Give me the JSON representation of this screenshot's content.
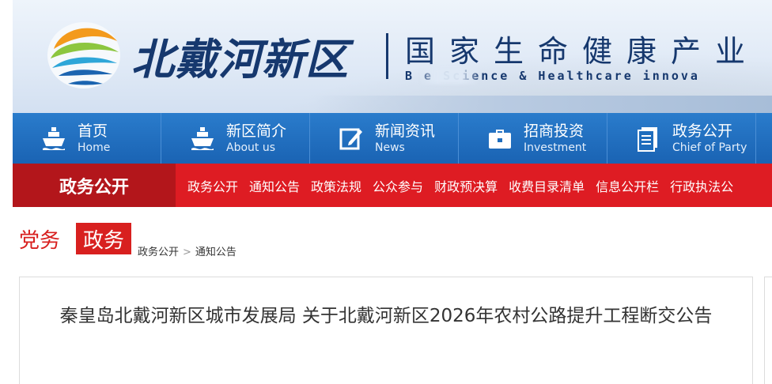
{
  "banner": {
    "logo_name": "北戴河新区",
    "title": "国家生命健康产业",
    "subtitle": "B          e Science & Healthcare innova"
  },
  "nav": {
    "items": [
      {
        "cn": "首页",
        "en": "Home",
        "icon": "ship-icon"
      },
      {
        "cn": "新区简介",
        "en": "About us",
        "icon": "ship-icon"
      },
      {
        "cn": "新闻资讯",
        "en": "News",
        "icon": "edit-icon"
      },
      {
        "cn": "招商投资",
        "en": "Investment",
        "icon": "briefcase-icon"
      },
      {
        "cn": "政务公开",
        "en": "Chief of Party",
        "icon": "document-icon"
      }
    ]
  },
  "subnav": {
    "label": "政务公开",
    "links": [
      "政务公开",
      "通知公告",
      "政策法规",
      "公众参与",
      "财政预决算",
      "收费目录清单",
      "信息公开栏",
      "行政执法公"
    ]
  },
  "section_tabs": {
    "dangwu": "党务",
    "zhengwu": "政务"
  },
  "breadcrumb": {
    "items": [
      "政务公开",
      "通知公告"
    ],
    "separator": ">"
  },
  "article": {
    "title": "秦皇岛北戴河新区城市发展局 关于北戴河新区2026年农村公路提升工程断交公告"
  },
  "colors": {
    "nav_blue": "#1f6dbd",
    "subnav_red": "#de1c23",
    "subnav_label_red": "#b3161b",
    "brand_navy": "#16386e"
  }
}
